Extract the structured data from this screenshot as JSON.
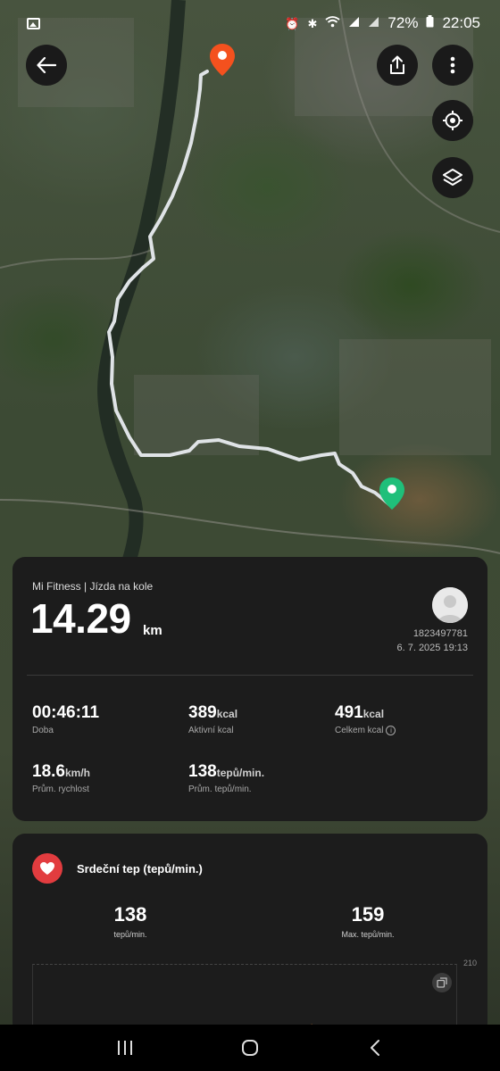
{
  "status_bar": {
    "battery": "72%",
    "time": "22:05",
    "icons": [
      "gallery-icon",
      "alarm-icon",
      "bluetooth-icon",
      "wifi-icon",
      "signal-icon",
      "signal-icon-2",
      "battery-icon"
    ]
  },
  "map": {
    "toolbar_icons": [
      "back-arrow-icon",
      "share-icon",
      "more-vertical-icon",
      "my-location-icon",
      "layers-icon"
    ],
    "route_color": "#dfe3e6",
    "start_pin_color": "#f4511e",
    "end_pin_color": "#1fbf7a"
  },
  "summary": {
    "brand": "Mi Fitness | Jízda na kole",
    "distance_value": "14.29",
    "distance_unit": "km",
    "user_id": "1823497781",
    "date": "6. 7. 2025 19:13",
    "stats": [
      {
        "value": "00:46:11",
        "unit": "",
        "label": "Doba"
      },
      {
        "value": "389",
        "unit": "kcal",
        "label": "Aktivní kcal"
      },
      {
        "value": "491",
        "unit": "kcal",
        "label": "Celkem kcal"
      },
      {
        "value": "18.6",
        "unit": "km/h",
        "label": "Prům. rychlost"
      },
      {
        "value": "138",
        "unit": "tepů/min.",
        "label": "Prům. tepů/min."
      }
    ]
  },
  "heart_rate": {
    "title": "Srdeční tep (tepů/min.)",
    "avg_value": "138",
    "avg_unit": "tepů/min.",
    "max_value": "159",
    "max_label": "Max. tepů/min.",
    "axis_max": "210",
    "accent_color": "#e23c3f"
  },
  "navbar": {
    "icons": [
      "recent-apps-icon",
      "home-icon",
      "back-icon"
    ]
  }
}
